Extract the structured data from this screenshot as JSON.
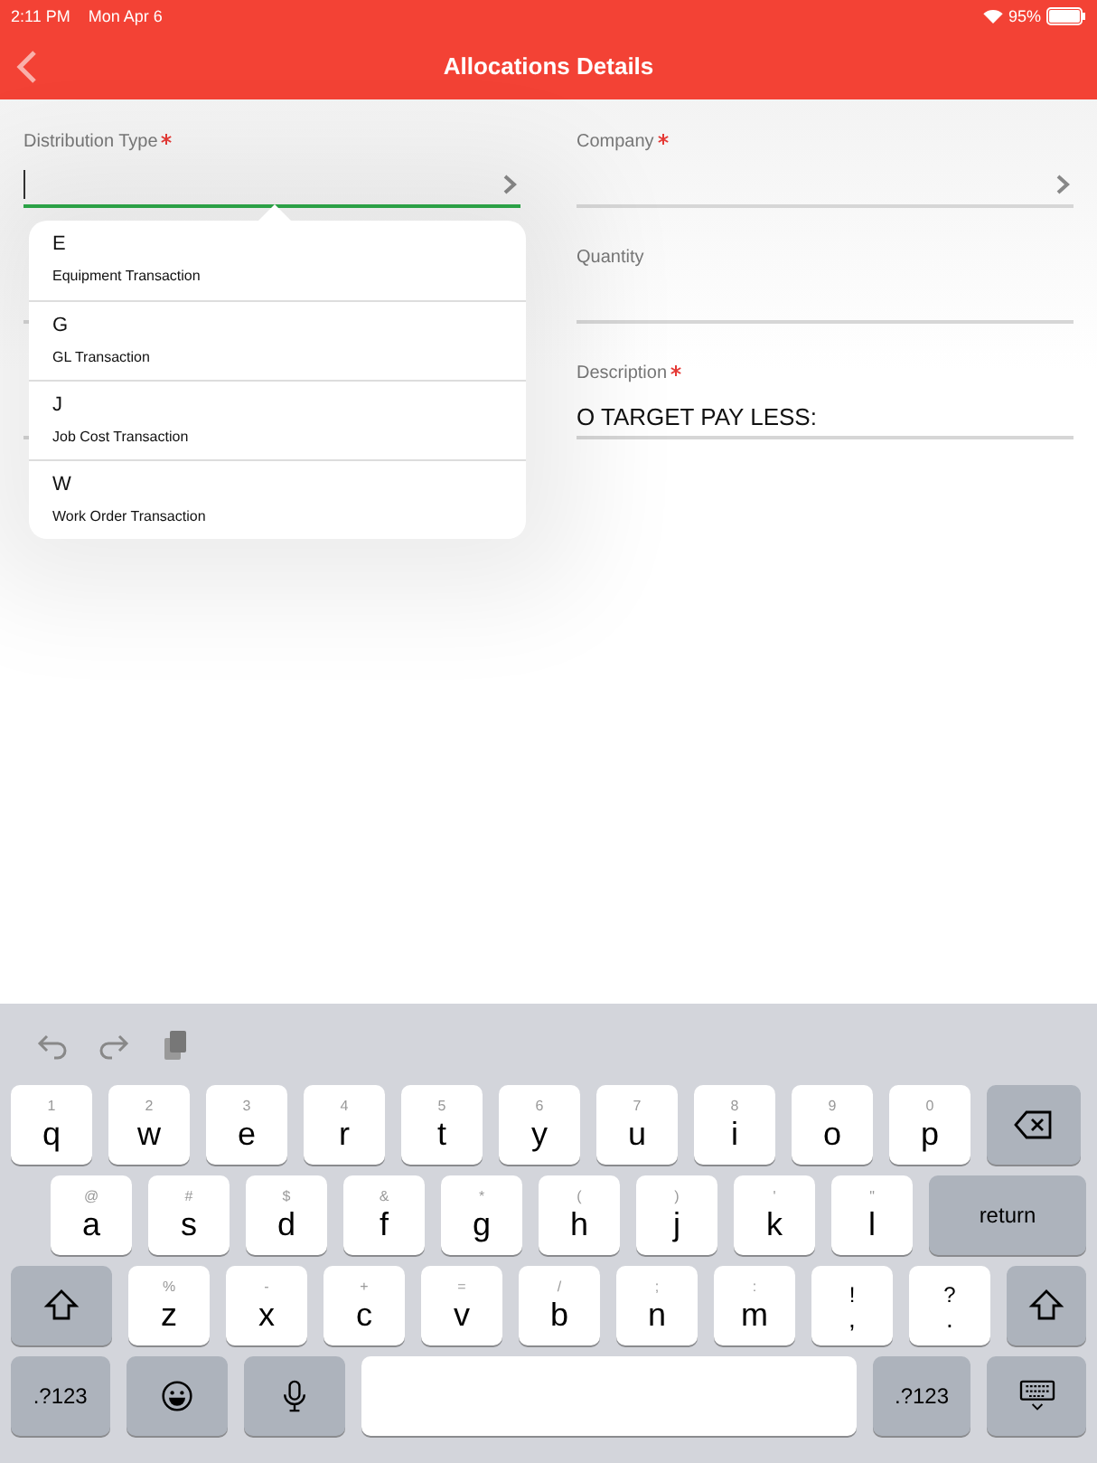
{
  "status_bar": {
    "time": "2:11 PM",
    "date": "Mon Apr 6",
    "battery": "95%"
  },
  "nav_bar": {
    "title": "Allocations Details"
  },
  "form": {
    "left": [
      {
        "kind": "picker",
        "label": "Distribution Type",
        "required": true,
        "focused": true
      },
      {
        "kind": "text",
        "focused": false
      },
      {
        "kind": "text",
        "focused": false
      }
    ],
    "right": [
      {
        "kind": "picker",
        "label": "Company",
        "required": true,
        "focused": false
      },
      {
        "kind": "text",
        "label": "Quantity",
        "required": false,
        "focused": false
      },
      {
        "kind": "text",
        "label": "Description",
        "required": true,
        "focused": false,
        "value": "O TARGET PAY LESS:"
      }
    ]
  },
  "popover": {
    "items": [
      {
        "code": "E",
        "label": "Equipment Transaction"
      },
      {
        "code": "G",
        "label": "GL Transaction"
      },
      {
        "code": "J",
        "label": "Job Cost Transaction"
      },
      {
        "code": "W",
        "label": "Work Order Transaction"
      }
    ]
  },
  "keyboard": {
    "toolbar": [
      {
        "kind": "undo"
      },
      {
        "kind": "redo"
      },
      {
        "kind": "paste"
      }
    ],
    "rows": [
      [
        {
          "kind": "letter",
          "main": "q",
          "alt": "1"
        },
        {
          "kind": "letter",
          "main": "w",
          "alt": "2"
        },
        {
          "kind": "letter",
          "main": "e",
          "alt": "3"
        },
        {
          "kind": "letter",
          "main": "r",
          "alt": "4"
        },
        {
          "kind": "letter",
          "main": "t",
          "alt": "5"
        },
        {
          "kind": "letter",
          "main": "y",
          "alt": "6"
        },
        {
          "kind": "letter",
          "main": "u",
          "alt": "7"
        },
        {
          "kind": "letter",
          "main": "i",
          "alt": "8"
        },
        {
          "kind": "letter",
          "main": "o",
          "alt": "9"
        },
        {
          "kind": "letter",
          "main": "p",
          "alt": "0"
        },
        {
          "kind": "delete"
        }
      ],
      [
        {
          "kind": "letter",
          "main": "a",
          "alt": "@"
        },
        {
          "kind": "letter",
          "main": "s",
          "alt": "#"
        },
        {
          "kind": "letter",
          "main": "d",
          "alt": "$"
        },
        {
          "kind": "letter",
          "main": "f",
          "alt": "&"
        },
        {
          "kind": "letter",
          "main": "g",
          "alt": "*"
        },
        {
          "kind": "letter",
          "main": "h",
          "alt": "("
        },
        {
          "kind": "letter",
          "main": "j",
          "alt": ")"
        },
        {
          "kind": "letter",
          "main": "k",
          "alt": "'"
        },
        {
          "kind": "letter",
          "main": "l",
          "alt": "\""
        },
        {
          "kind": "return",
          "main": "return"
        }
      ],
      [
        {
          "kind": "shift"
        },
        {
          "kind": "letter",
          "main": "z",
          "alt": "%"
        },
        {
          "kind": "letter",
          "main": "x",
          "alt": "-"
        },
        {
          "kind": "letter",
          "main": "c",
          "alt": "+"
        },
        {
          "kind": "letter",
          "main": "v",
          "alt": "="
        },
        {
          "kind": "letter",
          "main": "b",
          "alt": "/"
        },
        {
          "kind": "letter",
          "main": "n",
          "alt": ";"
        },
        {
          "kind": "letter",
          "main": "m",
          "alt": ":"
        },
        {
          "kind": "punct",
          "main": ",",
          "alt": "!"
        },
        {
          "kind": "punct",
          "main": ".",
          "alt": "?"
        },
        {
          "kind": "shift"
        }
      ],
      [
        {
          "kind": "mode",
          "main": ".?123"
        },
        {
          "kind": "emoji"
        },
        {
          "kind": "mic"
        },
        {
          "kind": "space"
        },
        {
          "kind": "mode",
          "main": ".?123"
        },
        {
          "kind": "hide"
        }
      ]
    ]
  }
}
